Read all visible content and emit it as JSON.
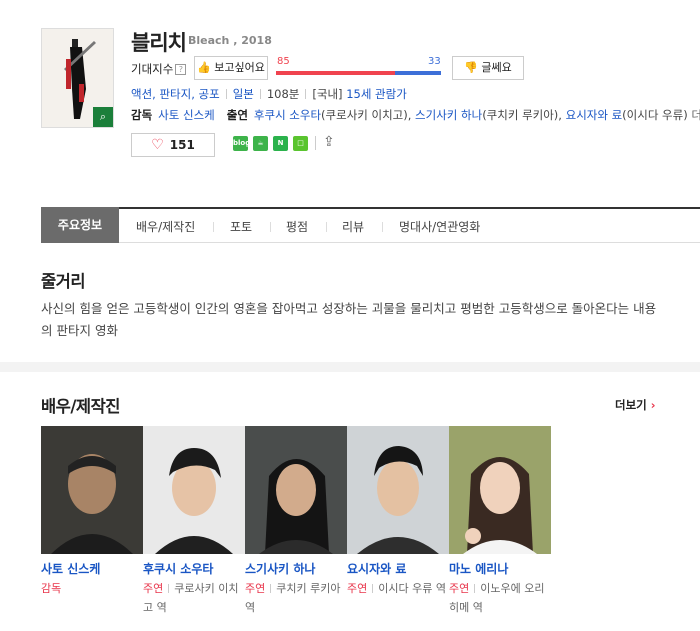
{
  "movie": {
    "title": "블리치",
    "subtitle": "Bleach , 2018",
    "zoom_icon": "search-icon"
  },
  "expect": {
    "label": "기대지수",
    "help": "?",
    "want_label": "보고싶어요",
    "doubt_label": "글쎄요",
    "want_score": "85",
    "doubt_score": "33",
    "want_ratio": 0.72,
    "want_color": "#f0434f",
    "doubt_color": "#3d6fd8"
  },
  "info": {
    "genre": "액션, 판타지, 공포",
    "country": "일본",
    "runtime": "108분",
    "rating_prefix": "[국내]",
    "rating": "15세 관람가",
    "director_label": "감독",
    "director": "사토 신스케",
    "cast_label": "출연",
    "cast_line": [
      {
        "name": "후쿠시 소우타",
        "role": "(쿠로사키 이치고),"
      },
      {
        "name": "스기사키 하나",
        "role": "(쿠치키 루키아),"
      },
      {
        "name": "요시자와 료",
        "role": "(이시다 우류)"
      }
    ],
    "more_label": "더보기"
  },
  "like": {
    "count": "151"
  },
  "sns": [
    {
      "name": "blog-icon",
      "label": "blog",
      "color": "#3db34a"
    },
    {
      "name": "cafe-icon",
      "label": "☕",
      "color": "#3db34a"
    },
    {
      "name": "band-icon",
      "label": "N",
      "color": "#2bb24c"
    },
    {
      "name": "memo-icon",
      "label": "□",
      "color": "#5ac42f"
    }
  ],
  "tabs": [
    "주요정보",
    "배우/제작진",
    "포토",
    "평점",
    "리뷰",
    "명대사/연관영화"
  ],
  "plot": {
    "heading": "줄거리",
    "text": "사신의 힘을 얻은 고등학생이 인간의 영혼을 잡아먹고 성장하는 괴물을 물리치고 평범한 고등학생으로 돌아온다는 내용의 판타지 영화"
  },
  "cast_section": {
    "heading": "배우/제작진",
    "more_label": "더보기",
    "people": [
      {
        "name": "사토 신스케",
        "role_type": "감독",
        "role": ""
      },
      {
        "name": "후쿠시 소우타",
        "role_type": "주연",
        "role": "쿠로사키 이치고 역"
      },
      {
        "name": "스기사키 하나",
        "role_type": "주연",
        "role": "쿠치키 루키아 역"
      },
      {
        "name": "요시자와 료",
        "role_type": "주연",
        "role": "이시다 우류 역"
      },
      {
        "name": "마노 에리나",
        "role_type": "주연",
        "role": "이노우에 오리히메 역"
      }
    ]
  }
}
